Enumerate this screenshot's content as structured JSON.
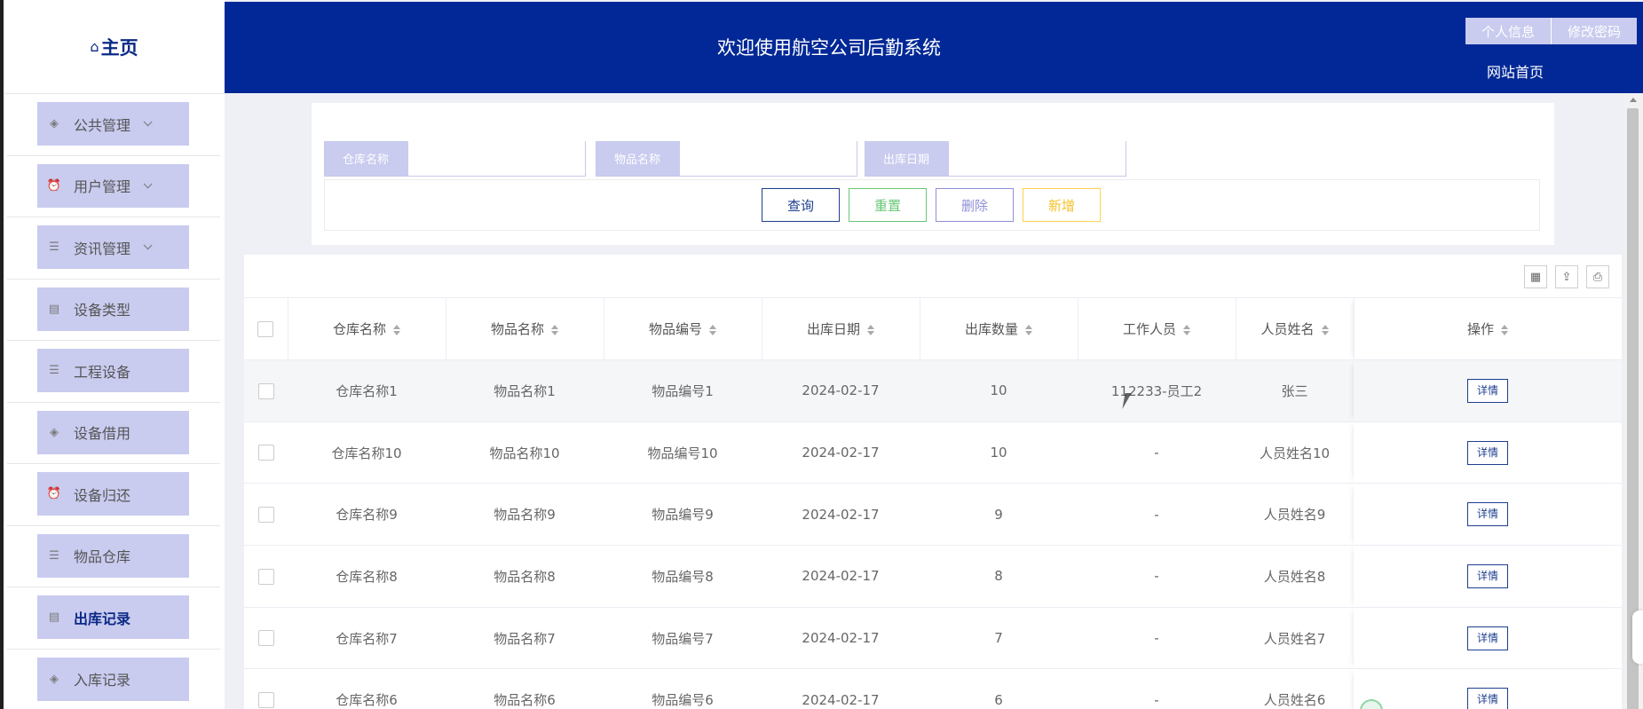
{
  "sidebar": {
    "brand": "主页",
    "items": [
      {
        "label": "公共管理",
        "icon": "layers-icon",
        "has_children": true
      },
      {
        "label": "用户管理",
        "icon": "alarm-icon",
        "has_children": true
      },
      {
        "label": "资讯管理",
        "icon": "list-icon",
        "has_children": true
      },
      {
        "label": "设备类型",
        "icon": "clipboard-icon",
        "has_children": false
      },
      {
        "label": "工程设备",
        "icon": "list-icon",
        "has_children": false
      },
      {
        "label": "设备借用",
        "icon": "layers-icon",
        "has_children": false
      },
      {
        "label": "设备归还",
        "icon": "alarm-icon",
        "has_children": false
      },
      {
        "label": "物品仓库",
        "icon": "list-icon",
        "has_children": false
      },
      {
        "label": "出库记录",
        "icon": "clipboard-icon",
        "has_children": false,
        "active": true
      },
      {
        "label": "入库记录",
        "icon": "layers-icon",
        "has_children": false
      }
    ]
  },
  "header": {
    "title": "欢迎使用航空公司后勤系统",
    "profile_label": "个人信息",
    "password_label": "修改密码",
    "site_home_label": "网站首页"
  },
  "search": {
    "warehouse_label": "仓库名称",
    "item_label": "物品名称",
    "date_label": "出库日期",
    "warehouse_value": "",
    "item_value": "",
    "date_value": "",
    "query_label": "查询",
    "reset_label": "重置",
    "delete_label": "删除",
    "add_label": "新增"
  },
  "table": {
    "columns": [
      "仓库名称",
      "物品名称",
      "物品编号",
      "出库日期",
      "出库数量",
      "工作人员",
      "人员姓名",
      "操作"
    ],
    "detail_label": "详情",
    "rows": [
      [
        "仓库名称1",
        "物品名称1",
        "物品编号1",
        "2024-02-17",
        "10",
        "112233-员工2",
        "张三"
      ],
      [
        "仓库名称10",
        "物品名称10",
        "物品编号10",
        "2024-02-17",
        "10",
        "-",
        "人员姓名10"
      ],
      [
        "仓库名称9",
        "物品名称9",
        "物品编号9",
        "2024-02-17",
        "9",
        "-",
        "人员姓名9"
      ],
      [
        "仓库名称8",
        "物品名称8",
        "物品编号8",
        "2024-02-17",
        "8",
        "-",
        "人员姓名8"
      ],
      [
        "仓库名称7",
        "物品名称7",
        "物品编号7",
        "2024-02-17",
        "7",
        "-",
        "人员姓名7"
      ],
      [
        "仓库名称6",
        "物品名称6",
        "物品编号6",
        "2024-02-17",
        "6",
        "-",
        "人员姓名6"
      ]
    ]
  },
  "colors": {
    "header_bg": "#012896",
    "menu_bg": "#c9cbef",
    "primary": "#1d3e8f",
    "success": "#67c777",
    "danger_soft": "#8f8fd8",
    "warning": "#f6c22b"
  }
}
